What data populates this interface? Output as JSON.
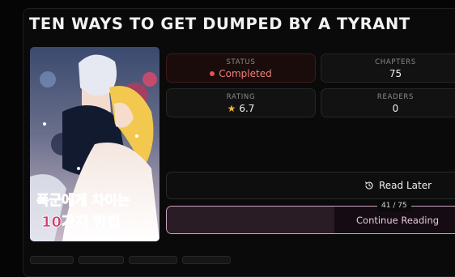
{
  "title": "TEN WAYS TO GET DUMPED BY A TYRANT",
  "cover": {
    "title_ko_line1": "폭군에게 차이는",
    "title_ko_line2": "10가지 방법"
  },
  "stats": {
    "status": {
      "label": "STATUS",
      "value": "Completed"
    },
    "chapters": {
      "label": "CHAPTERS",
      "value": "75"
    },
    "rating": {
      "label": "RATING",
      "value": "6.7"
    },
    "readers": {
      "label": "READERS",
      "value": "0"
    }
  },
  "actions": {
    "read_later_label": "Read Later",
    "continue_label": "Continue Reading",
    "progress_text": "41 / 75",
    "progress_fraction": 0.5467
  },
  "colors": {
    "status_accent": "#e05555",
    "star": "#f1b63a",
    "continue_border": "#c9a8c0"
  },
  "icons": {
    "status": "dot-icon",
    "rating": "star-icon",
    "read_later": "history-clock-icon"
  }
}
